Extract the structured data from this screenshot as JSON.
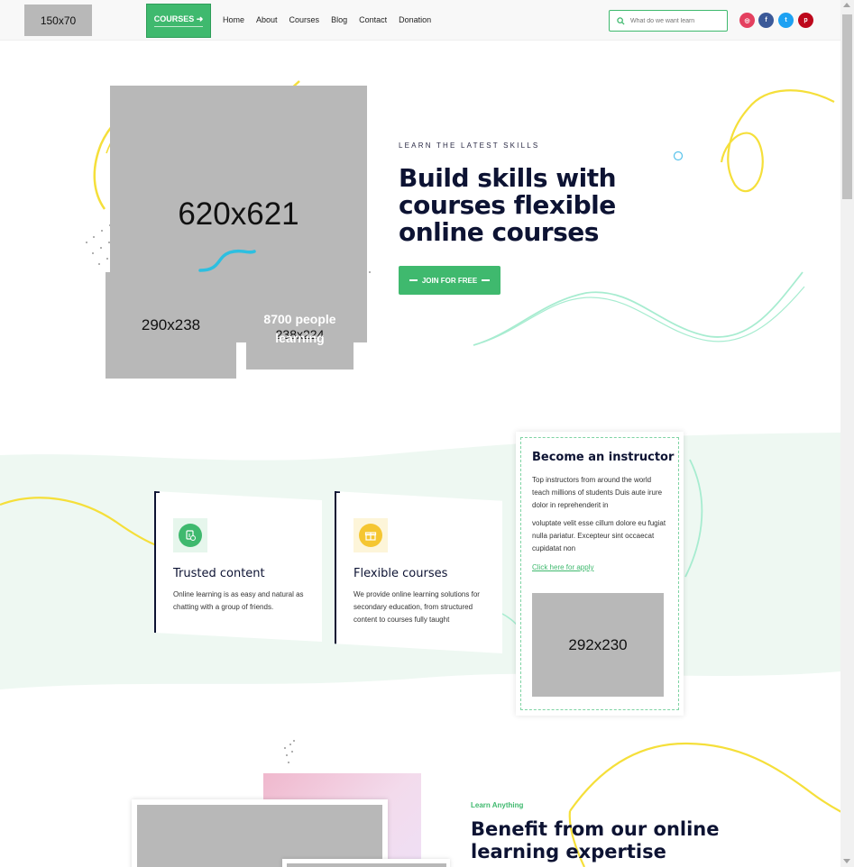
{
  "header": {
    "logo_placeholder": "150x70",
    "courses_button": "COURSES",
    "nav": [
      "Home",
      "About",
      "Courses",
      "Blog",
      "Contact",
      "Donation"
    ],
    "search_placeholder": "What do we want learn",
    "social": [
      {
        "name": "instagram",
        "glyph": "◎",
        "color": "#e4405f"
      },
      {
        "name": "facebook",
        "glyph": "f",
        "color": "#3b5998"
      },
      {
        "name": "twitter",
        "glyph": "t",
        "color": "#1da1f2"
      },
      {
        "name": "pinterest",
        "glyph": "p",
        "color": "#bd081c"
      }
    ]
  },
  "hero": {
    "main_image": "620x621",
    "small_image": "290x238",
    "badge_image": "238x224",
    "badge_text": "8700 people learning",
    "kicker": "LEARN THE LATEST SKILLS",
    "title": "Build skills with courses flexible online courses",
    "cta": "JOIN FOR FREE"
  },
  "features": [
    {
      "title": "Trusted content",
      "text": "Online learning is as easy and natural as chatting with a group of friends.",
      "icon": "clipboard-check-icon",
      "icon_color": "#3fb96e"
    },
    {
      "title": "Flexible courses",
      "text": "We provide online learning solutions for secondary education, from structured content to courses fully taught",
      "icon": "gift-box-icon",
      "icon_color": "#f5c631"
    }
  ],
  "instructor": {
    "title": "Become an instructor",
    "text1": "Top instructors from around the world teach millions of students Duis aute irure dolor in reprehenderit in",
    "text2": "voluptate velit esse cillum dolore eu fugiat nulla pariatur. Excepteur sint occaecat cupidatat non",
    "link": "Click here for apply",
    "image": "292x230"
  },
  "benefit": {
    "kicker": "Learn Anything",
    "title": "Benefit from our online learning expertise"
  },
  "colors": {
    "accent": "#3fb96e",
    "dark": "#0d1333",
    "yellow": "#f5e03a",
    "mint": "#eef8f2"
  }
}
